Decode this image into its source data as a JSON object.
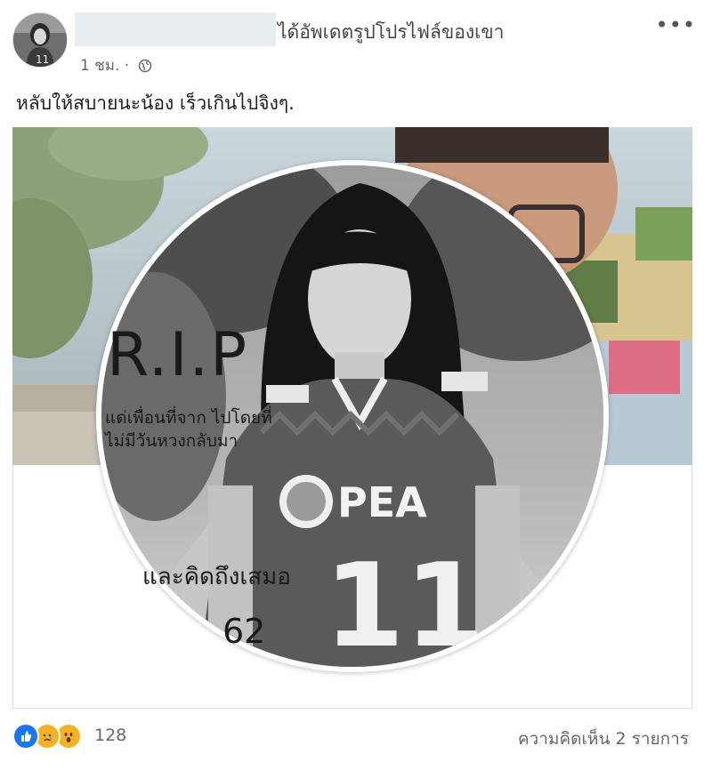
{
  "post": {
    "action": "ได้อัพเดตรูปโปรไฟล์ของเขา",
    "timestamp": "1 ชม.",
    "dot": "·",
    "privacy_icon": "globe-icon",
    "more_label": "•••",
    "caption": "หลับให้สบายนะน้อง เร็วเกินไปจิงๆ."
  },
  "image": {
    "rip": "R.I.P",
    "line1": "แด่เพื่อนที่จาก ไปโดยที่",
    "line2": "ไม่มีวันหวงกลับมา",
    "line3": "และคิดถึงเสมอ",
    "line4": "62",
    "jersey_sponsor": "PEA",
    "jersey_number": "11"
  },
  "footer": {
    "reactions": [
      "like-icon",
      "sad-icon",
      "wow-icon"
    ],
    "reaction_count": "128",
    "comments_label": "ความคิดเห็น 2 รายการ"
  },
  "colors": {
    "like": "#1877f2",
    "sad": "#f7b125",
    "wow": "#f7b125",
    "meta_text": "#65676b"
  }
}
